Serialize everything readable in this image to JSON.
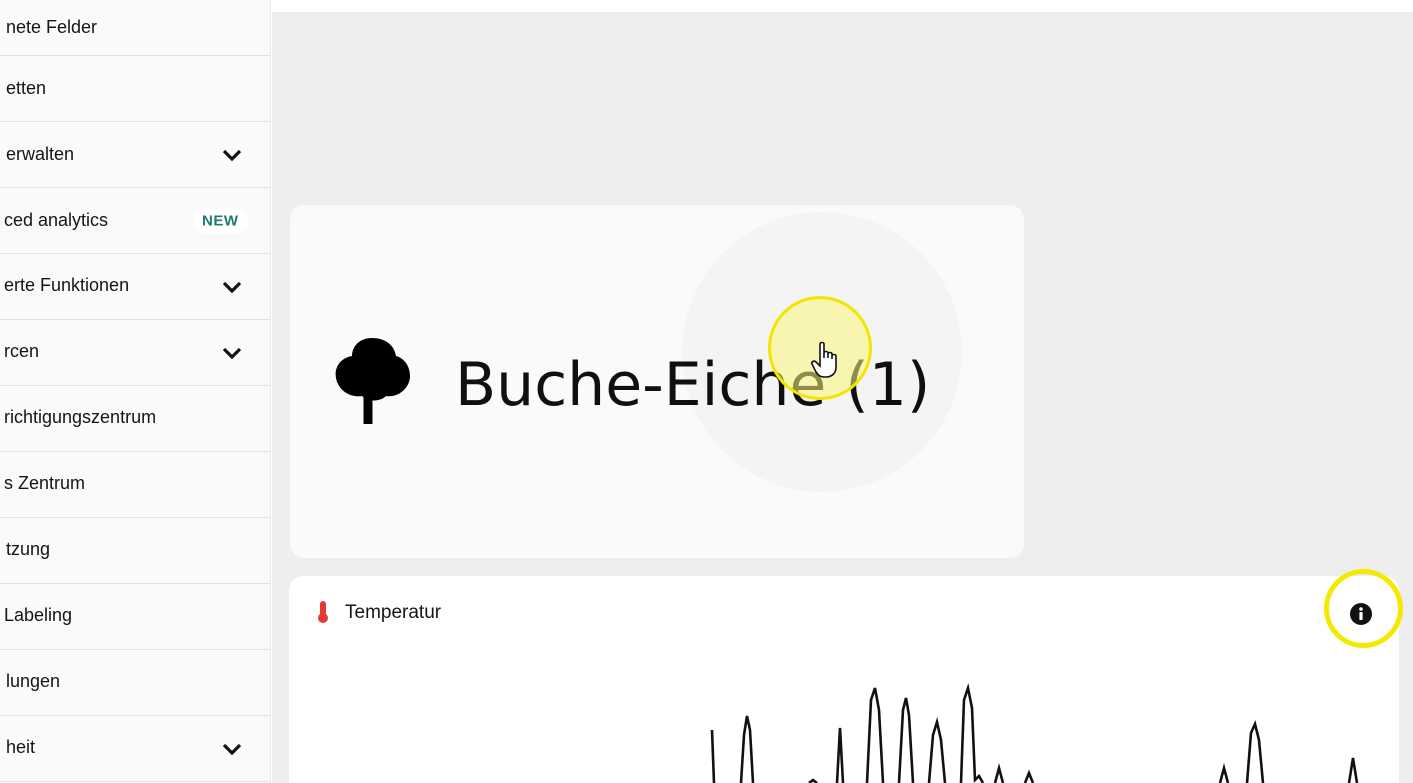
{
  "sidebar": {
    "items": [
      {
        "label": "nete Felder",
        "chevron": false,
        "badge": ""
      },
      {
        "label": "etten",
        "chevron": false,
        "badge": ""
      },
      {
        "label": "erwalten",
        "chevron": true,
        "badge": ""
      },
      {
        "label": "ced analytics",
        "chevron": false,
        "badge": "NEW"
      },
      {
        "label": "erte Funktionen",
        "chevron": true,
        "badge": ""
      },
      {
        "label": "rcen",
        "chevron": true,
        "badge": ""
      },
      {
        "label": "richtigungszentrum",
        "chevron": false,
        "badge": ""
      },
      {
        "label": "s Zentrum",
        "chevron": false,
        "badge": ""
      },
      {
        "label": "tzung",
        "chevron": false,
        "badge": ""
      },
      {
        "label": "Labeling",
        "chevron": false,
        "badge": ""
      },
      {
        "label": "lungen",
        "chevron": false,
        "badge": ""
      },
      {
        "label": "heit",
        "chevron": true,
        "badge": ""
      }
    ]
  },
  "species_card": {
    "icon": "tree-icon",
    "title": "Buche-Eiche (1)"
  },
  "temperature_card": {
    "icon": "thermometer-icon",
    "title": "Temperatur",
    "info_icon": "info-icon"
  },
  "colors": {
    "badge_text": "#1f7a72",
    "thermometer": "#e53935",
    "highlight": "#f4ea00",
    "background": "#eeeeee"
  }
}
